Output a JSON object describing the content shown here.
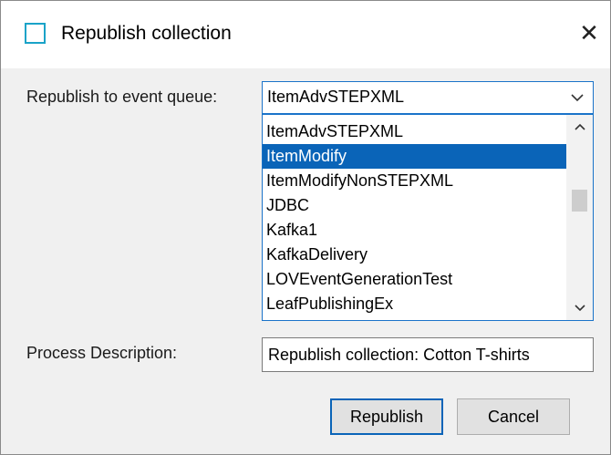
{
  "window": {
    "title": "Republish collection",
    "close_glyph": "✕"
  },
  "form": {
    "queue_label": "Republish to event queue:",
    "queue_selected": "ItemAdvSTEPXML",
    "queue_options_visible": [
      "ItemAdvSTEPXML",
      "ItemModify",
      "ItemModifyNonSTEPXML",
      "JDBC",
      "Kafka1",
      "KafkaDelivery",
      "LOVEventGenerationTest",
      "LeafPublishingEx"
    ],
    "highlighted_option": "ItemModify",
    "description_label": "Process Description:",
    "description_value": "Republish collection: Cotton T-shirts"
  },
  "buttons": {
    "republish": "Republish",
    "cancel": "Cancel"
  },
  "colors": {
    "accent": "#0a64b8",
    "focus_border": "#1a73c9",
    "title_icon": "#1aa3c8"
  },
  "icons": [
    "window-icon",
    "close-icon",
    "chevron-down-icon",
    "scroll-up-icon",
    "scroll-down-icon"
  ]
}
